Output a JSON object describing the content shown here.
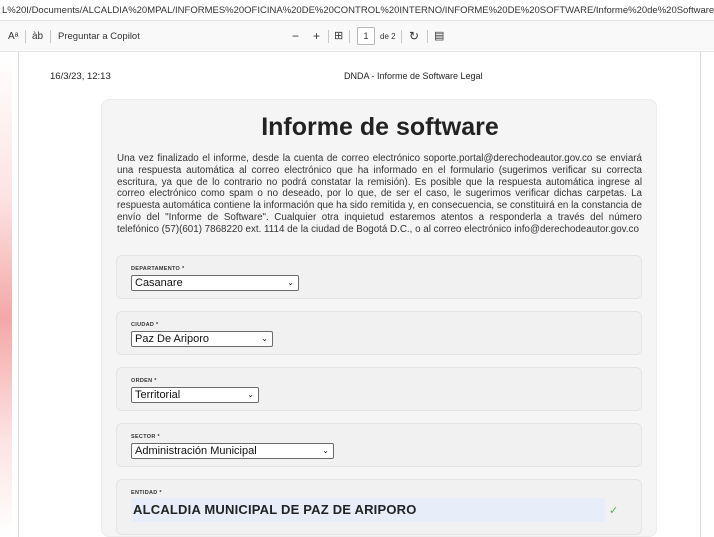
{
  "browser": {
    "url": "L%20I/Documents/ALCALDIA%20MPAL/INFORMES%20OFICINA%20DE%20CONTROL%20INTERNO/INFORME%20DE%20SOFTWARE/Informe%20de%20Software%202023%20-%20Derecho%20de%20A..."
  },
  "pdf_toolbar": {
    "read_aloud_icon": "Aᵃ",
    "immersive_icon": "àb",
    "copilot_label": "Preguntar a Copilot",
    "zoom_out": "−",
    "zoom_in": "+",
    "fit_icon": "⊞",
    "page_current": "1",
    "page_total": "de 2",
    "rotate_icon": "↻",
    "two_page_icon": "▤"
  },
  "document": {
    "header_datetime": "16/3/23, 12:13",
    "header_title": "DNDA - Informe de Software Legal",
    "title": "Informe de software",
    "intro": "Una vez finalizado el informe, desde la cuenta de correo electrónico soporte.portal@derechodeautor.gov.co se enviará una respuesta automática al correo electrónico que ha informado en el formulario (sugerimos verificar su correcta escritura, ya que de lo contrario no podrá constatar la remisión). Es posible que la respuesta automática ingrese al correo electrónico como spam o no deseado, por lo que, de ser el caso, le sugerimos verificar dichas carpetas. La respuesta automática contiene la información que ha sido remitida y, en consecuencia, se constituirá en la constancia de envío del \"Informe de Software\". Cualquier otra inquietud estaremos atentos a responderla a través del número telefónico (57)(601) 7868220 ext. 1114 de la ciudad de Bogotá D.C., o al correo electrónico info@derechodeautor.gov.co",
    "fields": {
      "departamento": {
        "label": "DEPARTAMENTO *",
        "value": "Casanare"
      },
      "ciudad": {
        "label": "CIUDAD *",
        "value": "Paz De Ariporo"
      },
      "orden": {
        "label": "ORDEN *",
        "value": "Territorial"
      },
      "sector": {
        "label": "SECTOR *",
        "value": "Administración Municipal"
      },
      "entidad": {
        "label": "ENTIDAD *",
        "value": "ALCALDIA MUNICIPAL DE PAZ DE ARIPORO"
      }
    },
    "chevron_icon": "⌄",
    "check_icon": "✓"
  }
}
